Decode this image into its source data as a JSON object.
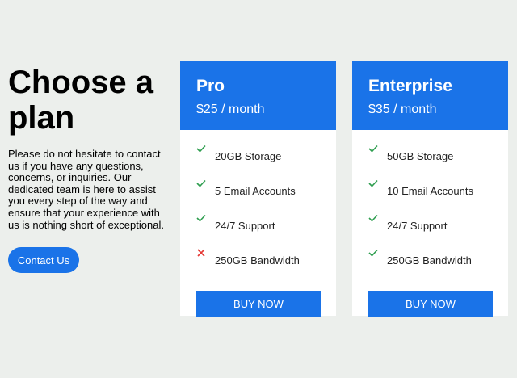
{
  "intro": {
    "heading": "Choose a plan",
    "description": "Please do not hesitate to contact us if you have any questions, concerns, or inquiries. Our dedicated team is here to assist you every step of the way and ensure that your experience with us is nothing short of exceptional.",
    "contact_label": "Contact Us"
  },
  "colors": {
    "accent": "#1a73e8",
    "check": "#2e9e4f",
    "cross": "#e53935",
    "background": "#ecefec"
  },
  "plans": [
    {
      "name": "Pro",
      "price": "$25 / month",
      "features": [
        {
          "label": "20GB Storage",
          "included": true,
          "icon": "check-icon"
        },
        {
          "label": "5 Email Accounts",
          "included": true,
          "icon": "check-icon"
        },
        {
          "label": "24/7 Support",
          "included": true,
          "icon": "check-icon"
        },
        {
          "label": "250GB Bandwidth",
          "included": false,
          "icon": "cross-icon"
        }
      ],
      "buy_label": "BUY NOW"
    },
    {
      "name": "Enterprise",
      "price": "$35 / month",
      "features": [
        {
          "label": "50GB Storage",
          "included": true,
          "icon": "check-icon"
        },
        {
          "label": "10 Email Accounts",
          "included": true,
          "icon": "check-icon"
        },
        {
          "label": "24/7 Support",
          "included": true,
          "icon": "check-icon"
        },
        {
          "label": "250GB Bandwidth",
          "included": true,
          "icon": "check-icon"
        }
      ],
      "buy_label": "BUY NOW"
    }
  ]
}
